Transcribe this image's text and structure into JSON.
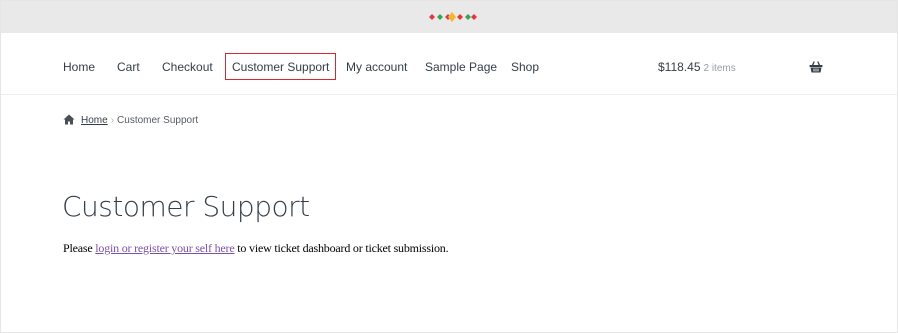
{
  "colors": {
    "topbar_bg": "#e9e9ea",
    "active_nav_border": "#d9262f",
    "link_purple": "#7b51a8",
    "text_dark": "#333e48",
    "logo_red": "#e2373f",
    "logo_green": "#36a44a",
    "logo_yellow": "#f3b533"
  },
  "header": {
    "logo_icon": "diamond-dots-logo"
  },
  "nav": {
    "items": [
      {
        "label": "Home"
      },
      {
        "label": "Cart"
      },
      {
        "label": "Checkout"
      },
      {
        "label": "Customer Support",
        "active": true
      },
      {
        "label": "My account"
      },
      {
        "label": "Sample Page"
      },
      {
        "label": "Shop"
      }
    ],
    "cart": {
      "total": "$118.45",
      "count": "2 items",
      "icon": "basket-icon"
    }
  },
  "breadcrumb": {
    "icon": "home-icon",
    "home": "Home",
    "separator": "›",
    "current": "Customer Support"
  },
  "page": {
    "title": "Customer Support",
    "notice_prefix": "Please ",
    "notice_link": "login or register your self here",
    "notice_suffix": " to view ticket dashboard or ticket submission."
  }
}
